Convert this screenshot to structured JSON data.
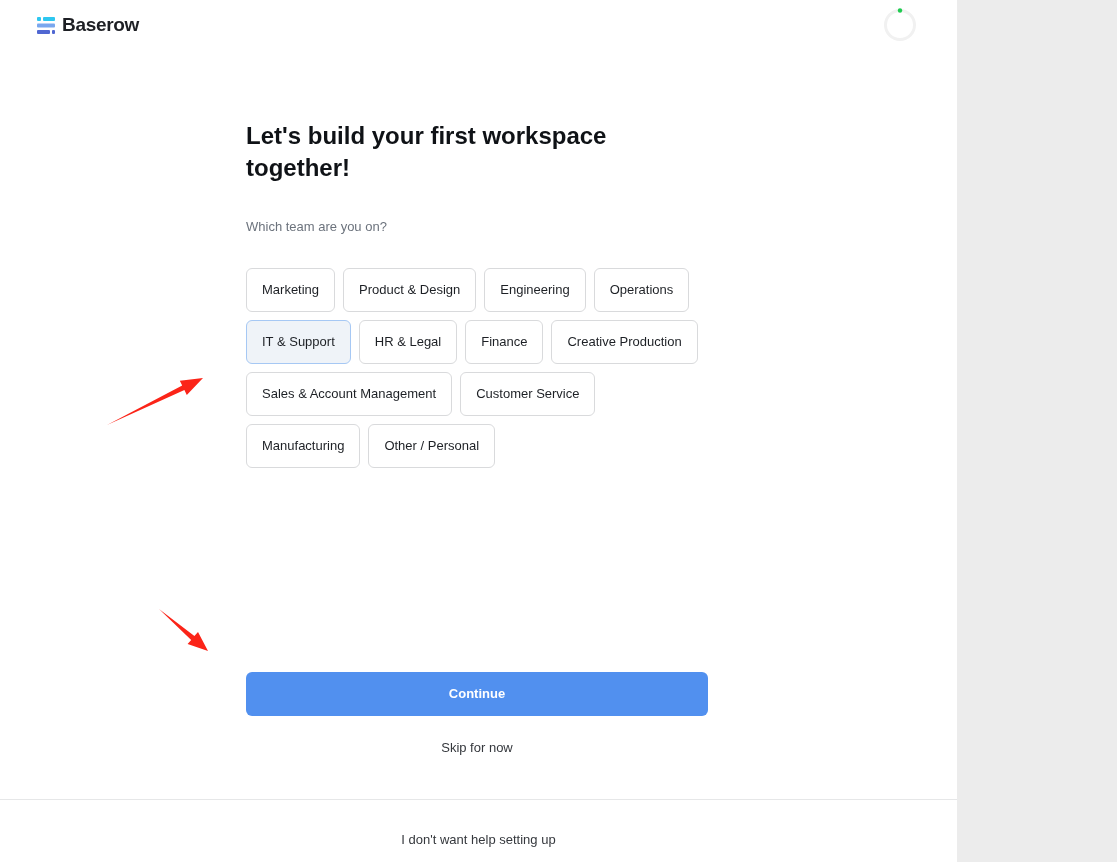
{
  "logo": {
    "text": "Baserow"
  },
  "heading": "Let's build your first workspace together!",
  "question": "Which team are you on?",
  "teams": [
    {
      "label": "Marketing",
      "selected": false
    },
    {
      "label": "Product & Design",
      "selected": false
    },
    {
      "label": "Engineering",
      "selected": false
    },
    {
      "label": "Operations",
      "selected": false
    },
    {
      "label": "IT & Support",
      "selected": true
    },
    {
      "label": "HR & Legal",
      "selected": false
    },
    {
      "label": "Finance",
      "selected": false
    },
    {
      "label": "Creative Production",
      "selected": false
    },
    {
      "label": "Sales & Account Management",
      "selected": false
    },
    {
      "label": "Customer Service",
      "selected": false
    },
    {
      "label": "Manufacturing",
      "selected": false
    },
    {
      "label": "Other / Personal",
      "selected": false
    }
  ],
  "continue_button": "Continue",
  "skip_link": "Skip for now",
  "footer_link": "I don't want help setting up"
}
